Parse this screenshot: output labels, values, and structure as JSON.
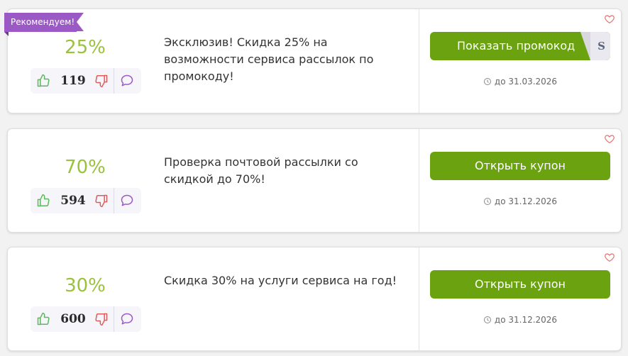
{
  "recommended_label": "Рекомендуем!",
  "coupons": [
    {
      "percent": "25%",
      "votes": "119",
      "description": "Эксклюзив! Скидка 25% на возможности сервиса рассылок по промокоду!",
      "button_label": "Показать промокод",
      "code_preview": "S",
      "expiry": "до 31.03.2026"
    },
    {
      "percent": "70%",
      "votes": "594",
      "description": "Проверка почтовой рассылки со скидкой до 70%!",
      "button_label": "Открыть купон",
      "expiry": "до 31.12.2026"
    },
    {
      "percent": "30%",
      "votes": "600",
      "description": "Скидка 30% на услуги сервиса на год!",
      "button_label": "Открыть купон",
      "expiry": "до 31.12.2026"
    }
  ],
  "icons": {
    "thumbs_up": "thumbs-up-icon",
    "thumbs_down": "thumbs-down-icon",
    "comment": "comment-icon",
    "clock": "clock-icon",
    "favorite": "heart-icon"
  },
  "colors": {
    "accent_green": "#6aa30f",
    "percent_green": "#9ac23c",
    "ribbon_purple": "#9b59c6",
    "like_green": "#5cb85c",
    "dislike_red": "#e05a5a",
    "comment_purple": "#9b59c6",
    "heart_red": "#e57373"
  }
}
